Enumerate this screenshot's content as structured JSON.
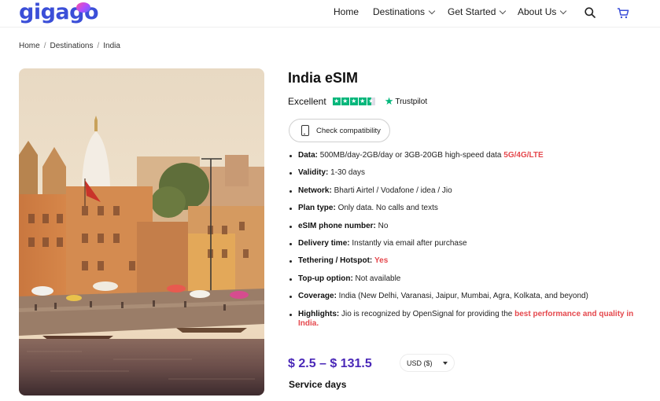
{
  "header": {
    "logo_text": "gigago",
    "nav": [
      {
        "label": "Home",
        "dropdown": false
      },
      {
        "label": "Destinations",
        "dropdown": true
      },
      {
        "label": "Get Started",
        "dropdown": true
      },
      {
        "label": "About Us",
        "dropdown": true
      }
    ],
    "icons": [
      "search-icon",
      "cart-icon"
    ]
  },
  "breadcrumb": [
    "Home",
    "Destinations",
    "India"
  ],
  "product": {
    "title": "India eSIM",
    "rating_label": "Excellent",
    "rating_stars": 4.5,
    "trustpilot_label": "Trustpilot",
    "compat_button": "Check compatibility",
    "specs": [
      {
        "label": "Data:",
        "text": " 500MB/day-2GB/day or 3GB-20GB high-speed data ",
        "highlight": "5G/4G/LTE"
      },
      {
        "label": "Validity:",
        "text": " 1-30 days"
      },
      {
        "label": "Network:",
        "text": " Bharti Airtel / Vodafone / idea / Jio"
      },
      {
        "label": "Plan type:",
        "text": " Only data. No calls and texts"
      },
      {
        "label": "eSIM phone number:",
        "text": " No"
      },
      {
        "label": "Delivery time:",
        "text": " Instantly via email after purchase"
      },
      {
        "label": "Tethering / Hotspot:",
        "text": " ",
        "highlight": "Yes"
      },
      {
        "label": "Top-up option:",
        "text": " Not available"
      },
      {
        "label": "Coverage:",
        "text": " India (New Delhi, Varanasi, Jaipur, Mumbai, Agra, Kolkata, and beyond)"
      },
      {
        "label": "Highlights:",
        "text": " Jio is recognized by OpenSignal for providing the ",
        "highlight": "best performance and quality in India."
      }
    ],
    "price": "$ 2.5 – $ 131.5",
    "currency": "USD ($)",
    "service_label": "Service days"
  },
  "colors": {
    "brand": "#3b4fd8",
    "price": "#4a28b8",
    "highlight_red": "#e5484d",
    "trustpilot_green": "#00b67a"
  }
}
